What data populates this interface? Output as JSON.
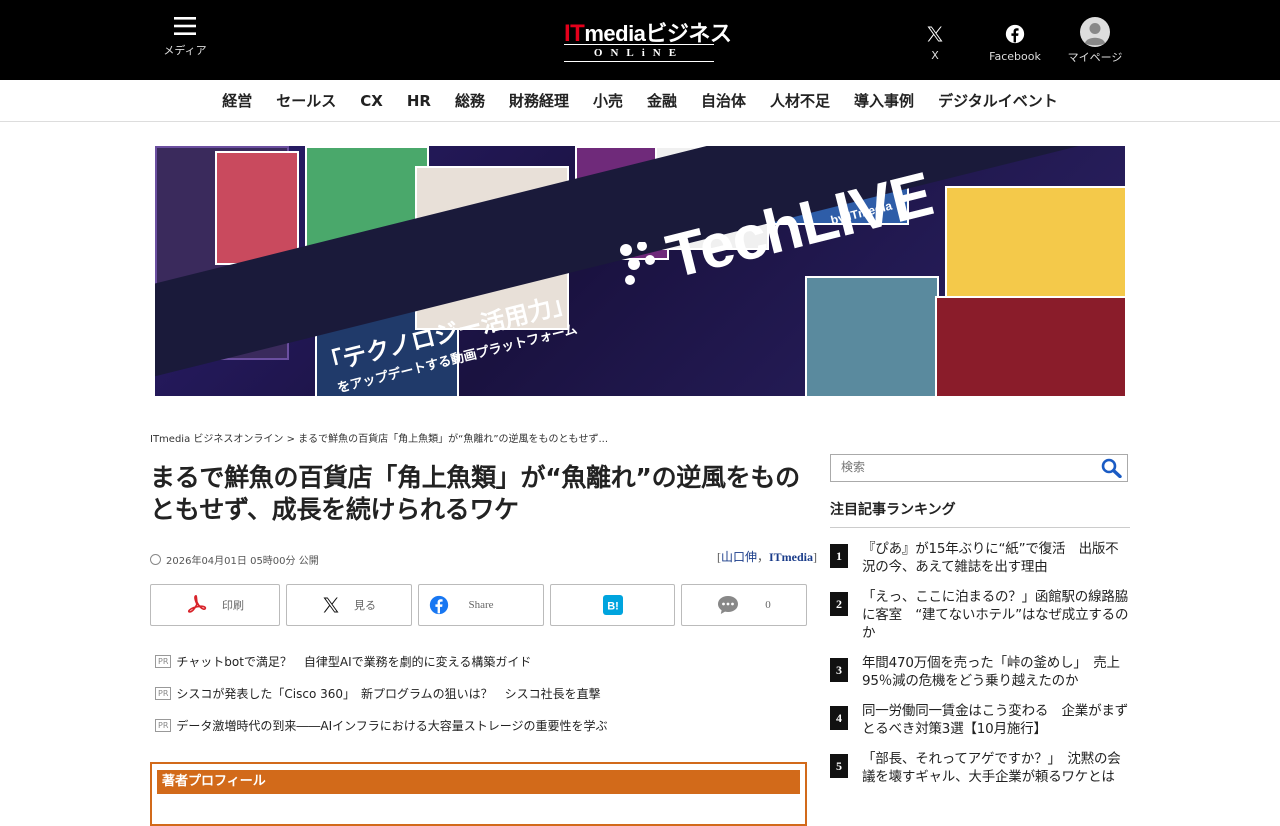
{
  "header": {
    "menu_label": "メディア",
    "logo_main": "ITmediaビジネス",
    "logo_it": "IT",
    "logo_rest": "mediaビジネス",
    "logo_sub": "ONLiNE",
    "x_label": "X",
    "facebook_label": "Facebook",
    "mypage_label": "マイページ"
  },
  "nav": {
    "items": [
      "経営",
      "セールス",
      "CX",
      "HR",
      "総務",
      "財務経理",
      "小売",
      "金融",
      "自治体",
      "人材不足",
      "導入事例",
      "デジタルイベント"
    ]
  },
  "banner": {
    "brand": "TechLIVE",
    "brand_by": "by ITmedia",
    "tagline": "「テクノロジー活用力」",
    "subtagline": "をアップデートする動画プラットフォーム"
  },
  "breadcrumb": {
    "home": "ITmedia ビジネスオンライン",
    "sep": " > ",
    "current": "まるで鮮魚の百貨店「角上魚類」が“魚離れ”の逆風をものともせず..."
  },
  "article": {
    "title": "まるで鮮魚の百貨店「角上魚類」が“魚離れ”の逆風をものともせず、成長を続けられるワケ",
    "published": "2026年04月01日 05時00分 公開",
    "author_open": "[",
    "author_name": "山口伸",
    "author_sep": "，",
    "author_org": "ITmedia",
    "author_close": "]"
  },
  "share": {
    "print": "印刷",
    "x": "見る",
    "facebook": "Share",
    "comment_count": "0"
  },
  "pr": {
    "badge": "PR",
    "items": [
      "チャットbotで満足？　自律型AIで業務を劇的に変える構築ガイド",
      "シスコが発表した「Cisco 360」　新プログラムの狙いは？　シスコ社長を直撃",
      "データ激増時代の到来――AIインフラにおける大容量ストレージの重要性を学ぶ"
    ]
  },
  "profile": {
    "heading": "著者プロフィール"
  },
  "sidebar": {
    "search_placeholder": "検索",
    "ranking_title": "注目記事ランキング",
    "ranking": [
      {
        "num": "1",
        "text": "『ぴあ』が15年ぶりに“紙”で復活　出版不況の今、あえて雑誌を出す理由"
      },
      {
        "num": "2",
        "text": "「えっ、ここに泊まるの？」函館駅の線路脇に客室　“建てないホテル”はなぜ成立するのか"
      },
      {
        "num": "3",
        "text": "年間470万個を売った「峠の釜めし」　売上95％減の危機をどう乗り越えたのか"
      },
      {
        "num": "4",
        "text": "同一労働同一賃金はこう変わる　企業がまずとるべき対策3選【10月施行】"
      },
      {
        "num": "5",
        "text": "「部長、それってアゲですか？」　沈黙の会議を壊すギャル、大手企業が頼るワケとは"
      }
    ]
  },
  "colors": {
    "header_bg": "#000000",
    "logo_red": "#e4001b",
    "profile_orange": "#d26a1a",
    "author_link": "#1a3c8a",
    "print_red": "#d8232a",
    "facebook_blue": "#1877f2",
    "hatena_blue": "#00a4de"
  }
}
